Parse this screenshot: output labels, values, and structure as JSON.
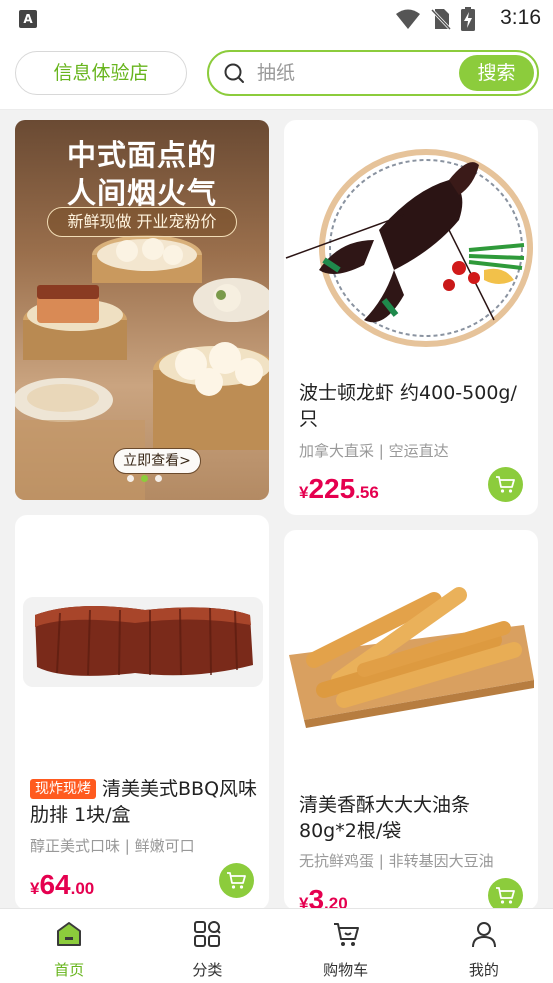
{
  "status_bar": {
    "app_badge": "A",
    "time": "3:16"
  },
  "header": {
    "store_button": "信息体验店",
    "search_placeholder": "抽纸",
    "search_button": "搜索"
  },
  "banner": {
    "title_line1": "中式面点的",
    "title_line2": "人间烟火气",
    "subtitle": "新鲜现做 开业宠粉价",
    "cta": "立即查看>",
    "dots": 3,
    "active_dot": 1
  },
  "products": [
    {
      "name": "波士顿龙虾 约400-500g/只",
      "desc": "加拿大直采 | 空运直达",
      "price_symbol": "¥",
      "price_int": "225",
      "price_dec": ".56",
      "image": "lobster-on-plate"
    },
    {
      "tag": "现炸现烤",
      "name": "清美美式BBQ风味肋排 1块/盒",
      "desc": "醇正美式口味 | 鲜嫩可口",
      "price_symbol": "¥",
      "price_int": "64",
      "price_dec": ".00",
      "image": "bbq-ribs"
    },
    {
      "name": "清美香酥大大大油条 80g*2根/袋",
      "desc": "无抗鲜鸡蛋 | 非转基因大豆油",
      "price_symbol": "¥",
      "price_int": "3",
      "price_dec": ".20",
      "image": "fried-dough-sticks"
    }
  ],
  "tabbar": {
    "tabs": [
      {
        "label": "首页",
        "icon": "home-icon",
        "active": true
      },
      {
        "label": "分类",
        "icon": "category-icon",
        "active": false
      },
      {
        "label": "购物车",
        "icon": "cart-icon",
        "active": false
      },
      {
        "label": "我的",
        "icon": "profile-icon",
        "active": false
      }
    ]
  },
  "colors": {
    "accent": "#8ccc3c",
    "accent_text": "#68b51e",
    "price": "#e5004f",
    "tag": "#ff5a1f"
  }
}
